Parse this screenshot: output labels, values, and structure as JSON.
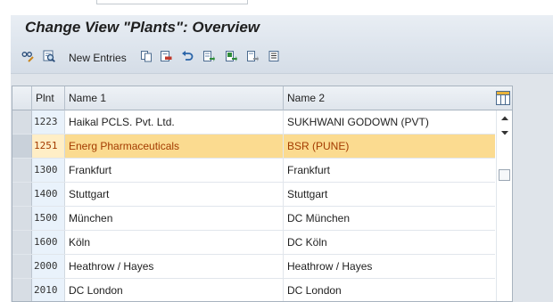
{
  "window": {
    "title": "Change View \"Plants\": Overview"
  },
  "toolbar": {
    "new_entries_label": "New Entries",
    "icons_left": [
      "display-change-icon",
      "details-icon"
    ],
    "icons_right": [
      "copy-icon",
      "delete-icon",
      "undo-icon",
      "select-all-icon",
      "select-block-icon",
      "deselect-all-icon",
      "print-field-icon"
    ]
  },
  "table": {
    "columns": {
      "plnt": "Plnt",
      "name1": "Name 1",
      "name2": "Name 2"
    },
    "highlight_color": "#fbdb90",
    "highlight_text_color": "#a33b00",
    "rows": [
      {
        "plnt": "1223",
        "name1": "Haikal PCLS. Pvt. Ltd.",
        "name2": "SUKHWANI GODOWN (PVT)",
        "highlighted": false
      },
      {
        "plnt": "1251",
        "name1": "Energ Pharmaceuticals",
        "name2": "BSR (PUNE)",
        "highlighted": true
      },
      {
        "plnt": "1300",
        "name1": "Frankfurt",
        "name2": "Frankfurt",
        "highlighted": false
      },
      {
        "plnt": "1400",
        "name1": "Stuttgart",
        "name2": "Stuttgart",
        "highlighted": false
      },
      {
        "plnt": "1500",
        "name1": "München",
        "name2": "DC München",
        "highlighted": false
      },
      {
        "plnt": "1600",
        "name1": "Köln",
        "name2": "DC Köln",
        "highlighted": false
      },
      {
        "plnt": "2000",
        "name1": "Heathrow / Hayes",
        "name2": "Heathrow / Hayes",
        "highlighted": false
      },
      {
        "plnt": "2010",
        "name1": "DC London",
        "name2": "DC London",
        "highlighted": false
      }
    ]
  }
}
